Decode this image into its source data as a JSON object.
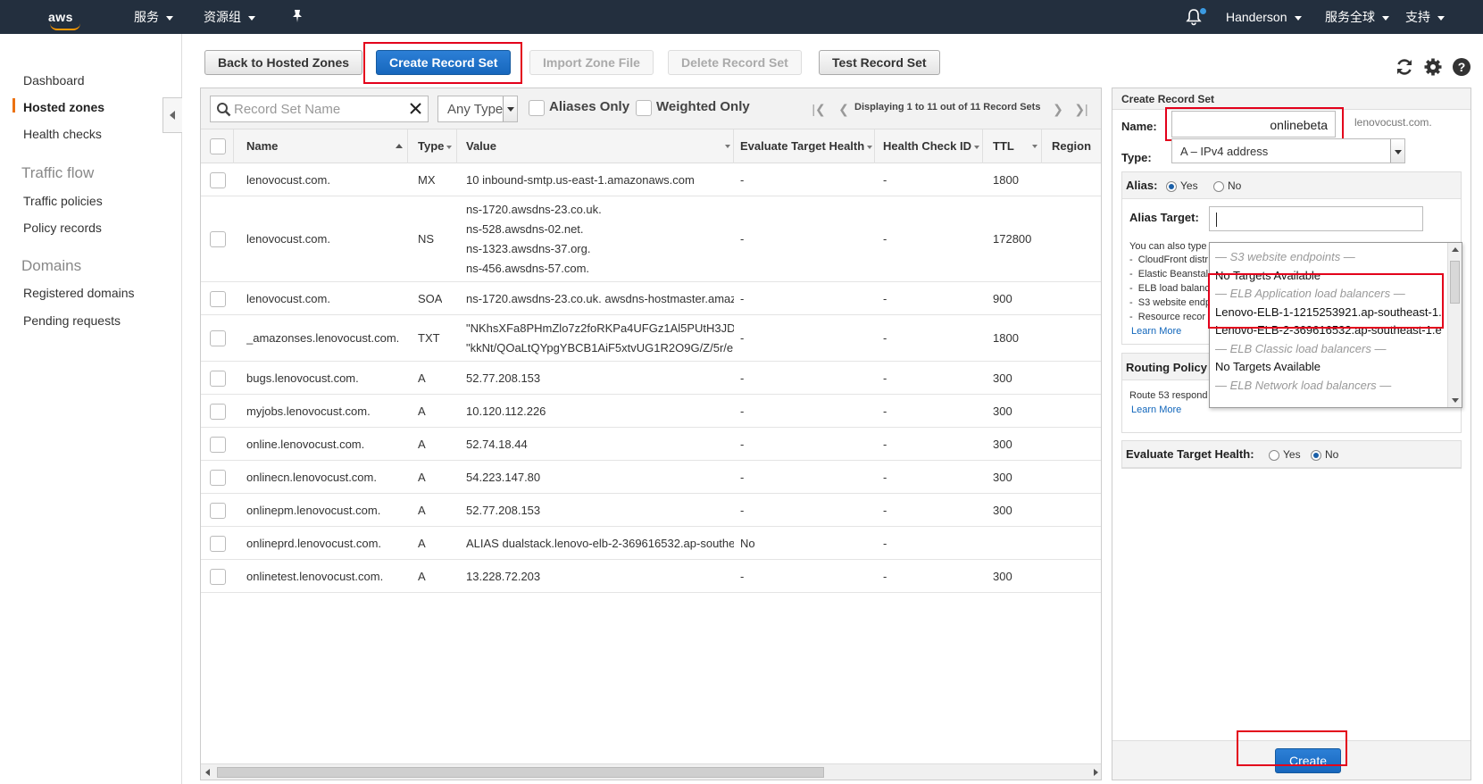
{
  "topnav": {
    "logo": "aws",
    "services": "服务",
    "resource_groups": "资源组",
    "user": "Handerson",
    "region": "服务全球",
    "support": "支持"
  },
  "sidebar": {
    "items": [
      {
        "label": "Dashboard"
      },
      {
        "label": "Hosted zones"
      },
      {
        "label": "Health checks"
      }
    ],
    "traffic_flow": {
      "title": "Traffic flow",
      "items": [
        {
          "label": "Traffic policies"
        },
        {
          "label": "Policy records"
        }
      ]
    },
    "domains": {
      "title": "Domains",
      "items": [
        {
          "label": "Registered domains"
        },
        {
          "label": "Pending requests"
        }
      ]
    }
  },
  "toolbar": {
    "back": "Back to Hosted Zones",
    "create": "Create Record Set",
    "import": "Import Zone File",
    "delete": "Delete Record Set",
    "test": "Test Record Set"
  },
  "filter": {
    "search_placeholder": "Record Set Name",
    "type_value": "Any Type",
    "aliases_only": "Aliases Only",
    "weighted_only": "Weighted Only",
    "pager": "Displaying 1 to 11 out of 11 Record Sets"
  },
  "table": {
    "columns": [
      "Name",
      "Type",
      "Value",
      "Evaluate Target Health",
      "Health Check ID",
      "TTL",
      "Region"
    ],
    "rows": [
      {
        "name": "lenovocust.com.",
        "type": "MX",
        "value": [
          "10 inbound-smtp.us-east-1.amazonaws.com"
        ],
        "eval": "-",
        "hc": "-",
        "ttl": "1800"
      },
      {
        "name": "lenovocust.com.",
        "type": "NS",
        "value": [
          "ns-1720.awsdns-23.co.uk.",
          "ns-528.awsdns-02.net.",
          "ns-1323.awsdns-37.org.",
          "ns-456.awsdns-57.com."
        ],
        "eval": "-",
        "hc": "-",
        "ttl": "172800"
      },
      {
        "name": "lenovocust.com.",
        "type": "SOA",
        "value": [
          "ns-1720.awsdns-23.co.uk. awsdns-hostmaster.amaz"
        ],
        "eval": "-",
        "hc": "-",
        "ttl": "900"
      },
      {
        "name": "_amazonses.lenovocust.com.",
        "type": "TXT",
        "value": [
          "\"NKhsXFa8PHmZlo7z2foRKPa4UFGz1Al5PUtH3JD",
          "\"kkNt/QOaLtQYpgYBCB1AiF5xtvUG1R2O9G/Z/5r/e"
        ],
        "eval": "-",
        "hc": "-",
        "ttl": "1800"
      },
      {
        "name": "bugs.lenovocust.com.",
        "type": "A",
        "value": [
          "52.77.208.153"
        ],
        "eval": "-",
        "hc": "-",
        "ttl": "300"
      },
      {
        "name": "myjobs.lenovocust.com.",
        "type": "A",
        "value": [
          "10.120.112.226"
        ],
        "eval": "-",
        "hc": "-",
        "ttl": "300"
      },
      {
        "name": "online.lenovocust.com.",
        "type": "A",
        "value": [
          "52.74.18.44"
        ],
        "eval": "-",
        "hc": "-",
        "ttl": "300"
      },
      {
        "name": "onlinecn.lenovocust.com.",
        "type": "A",
        "value": [
          "54.223.147.80"
        ],
        "eval": "-",
        "hc": "-",
        "ttl": "300"
      },
      {
        "name": "onlinepm.lenovocust.com.",
        "type": "A",
        "value": [
          "52.77.208.153"
        ],
        "eval": "-",
        "hc": "-",
        "ttl": "300"
      },
      {
        "name": "onlineprd.lenovocust.com.",
        "type": "A",
        "value": [
          "ALIAS dualstack.lenovo-elb-2-369616532.ap-southe"
        ],
        "eval": "No",
        "hc": "-",
        "ttl": ""
      },
      {
        "name": "onlinetest.lenovocust.com.",
        "type": "A",
        "value": [
          "13.228.72.203"
        ],
        "eval": "-",
        "hc": "-",
        "ttl": "300"
      }
    ]
  },
  "create_panel": {
    "title": "Create Record Set",
    "name_label": "Name:",
    "name_value": "onlinebeta",
    "domain_suffix": "lenovocust.com.",
    "type_label": "Type:",
    "type_value": "A – IPv4 address",
    "alias_label": "Alias:",
    "alias_yes": "Yes",
    "alias_no": "No",
    "alias_target_label": "Alias Target:",
    "alias_help": [
      "You can also type",
      "CloudFront distr",
      "Elastic Beanstal",
      "ELB load balanc",
      "S3 website endp",
      "Resource recor"
    ],
    "learn_more": "Learn More",
    "routing_label": "Routing Policy",
    "routing_help": "Route 53 respond",
    "eval_label": "Evaluate Target Health:",
    "eval_yes": "Yes",
    "eval_no": "No",
    "create_button": "Create",
    "dropdown": [
      {
        "kind": "grp",
        "text": "— S3 website endpoints —"
      },
      {
        "kind": "item",
        "text": "No Targets Available"
      },
      {
        "kind": "grp",
        "text": "— ELB Application load balancers —"
      },
      {
        "kind": "item",
        "text": "Lenovo-ELB-1-1215253921.ap-southeast-1."
      },
      {
        "kind": "item",
        "text": "Lenovo-ELB-2-369616532.ap-southeast-1.e"
      },
      {
        "kind": "grp",
        "text": "— ELB Classic load balancers —"
      },
      {
        "kind": "item",
        "text": "No Targets Available"
      },
      {
        "kind": "grp",
        "text": "— ELB Network load balancers —"
      }
    ]
  },
  "colors": {
    "nav_bg": "#232f3e",
    "accent_orange": "#ec7211",
    "primary_blue": "#1767bd",
    "highlight_red": "#e3001b"
  }
}
